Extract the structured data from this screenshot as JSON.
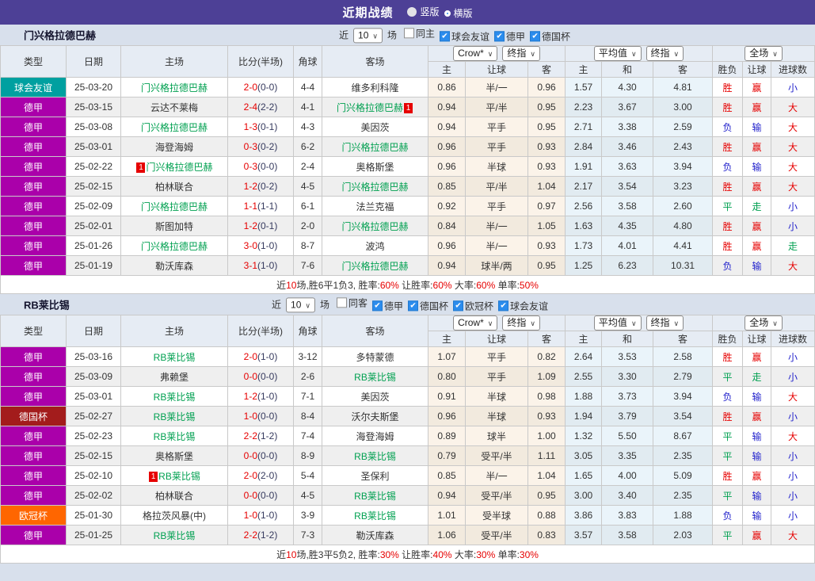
{
  "topbar": {
    "title": "近期战绩",
    "options": [
      {
        "label": "竖版",
        "selected": false
      },
      {
        "label": "横版",
        "selected": true
      }
    ]
  },
  "table_header": {
    "static": [
      "类型",
      "日期",
      "主场",
      "比分(半场)",
      "角球",
      "客场"
    ],
    "dropdowns": {
      "handicap": [
        "Crow*",
        "终指"
      ],
      "average": [
        "平均值",
        "终指"
      ],
      "result": [
        "全场"
      ]
    },
    "sub_labels": [
      "主",
      "让球",
      "客",
      "主",
      "和",
      "客",
      "胜负",
      "让球",
      "进球数"
    ]
  },
  "legend_colors": {
    "德甲": "#aa00aa",
    "德国杯": "#a31c1c",
    "欧冠杯": "#ff6600",
    "球会友谊": "#00a0a0"
  },
  "sections": [
    {
      "team": "门兴格拉德巴赫",
      "filters": {
        "near_label": "近",
        "count": "10",
        "games_label": "场",
        "checkboxes": [
          {
            "label": "同主",
            "checked": false
          },
          {
            "label": "球会友谊",
            "checked": true
          },
          {
            "label": "德甲",
            "checked": true
          },
          {
            "label": "德国杯",
            "checked": true
          }
        ]
      },
      "rows": [
        {
          "type": "球会友谊",
          "date": "25-03-20",
          "home": {
            "name": "门兴格拉德巴赫",
            "hl": true
          },
          "score_ft": "2-0",
          "score_ht": "(0-0)",
          "corner": "4-4",
          "away": {
            "name": "维多利科隆",
            "hl": false
          },
          "hcp": [
            "0.86",
            "半/一",
            "0.96"
          ],
          "avg": [
            "1.57",
            "4.30",
            "4.81"
          ],
          "results": [
            [
              "胜",
              "r"
            ],
            [
              "赢",
              "r"
            ],
            [
              "小",
              "b"
            ]
          ]
        },
        {
          "type": "德甲",
          "date": "25-03-15",
          "home": {
            "name": "云达不莱梅",
            "hl": false
          },
          "score_ft": "2-4",
          "score_ht": "(2-2)",
          "corner": "4-1",
          "away": {
            "name": "门兴格拉德巴赫",
            "hl": true,
            "badge": "1",
            "badge_pos": "after"
          },
          "hcp": [
            "0.94",
            "平/半",
            "0.95"
          ],
          "avg": [
            "2.23",
            "3.67",
            "3.00"
          ],
          "results": [
            [
              "胜",
              "r"
            ],
            [
              "赢",
              "r"
            ],
            [
              "大",
              "r"
            ]
          ]
        },
        {
          "type": "德甲",
          "date": "25-03-08",
          "home": {
            "name": "门兴格拉德巴赫",
            "hl": true
          },
          "score_ft": "1-3",
          "score_ht": "(0-1)",
          "corner": "4-3",
          "away": {
            "name": "美因茨",
            "hl": false
          },
          "hcp": [
            "0.94",
            "平手",
            "0.95"
          ],
          "avg": [
            "2.71",
            "3.38",
            "2.59"
          ],
          "results": [
            [
              "负",
              "b"
            ],
            [
              "输",
              "b"
            ],
            [
              "大",
              "r"
            ]
          ]
        },
        {
          "type": "德甲",
          "date": "25-03-01",
          "home": {
            "name": "海登海姆",
            "hl": false
          },
          "score_ft": "0-3",
          "score_ht": "(0-2)",
          "corner": "6-2",
          "away": {
            "name": "门兴格拉德巴赫",
            "hl": true
          },
          "hcp": [
            "0.96",
            "平手",
            "0.93"
          ],
          "avg": [
            "2.84",
            "3.46",
            "2.43"
          ],
          "results": [
            [
              "胜",
              "r"
            ],
            [
              "赢",
              "r"
            ],
            [
              "大",
              "r"
            ]
          ]
        },
        {
          "type": "德甲",
          "date": "25-02-22",
          "home": {
            "name": "门兴格拉德巴赫",
            "hl": true,
            "badge": "1",
            "badge_pos": "before"
          },
          "score_ft": "0-3",
          "score_ht": "(0-0)",
          "corner": "2-4",
          "away": {
            "name": "奥格斯堡",
            "hl": false
          },
          "hcp": [
            "0.96",
            "半球",
            "0.93"
          ],
          "avg": [
            "1.91",
            "3.63",
            "3.94"
          ],
          "results": [
            [
              "负",
              "b"
            ],
            [
              "输",
              "b"
            ],
            [
              "大",
              "r"
            ]
          ]
        },
        {
          "type": "德甲",
          "date": "25-02-15",
          "home": {
            "name": "柏林联合",
            "hl": false
          },
          "score_ft": "1-2",
          "score_ht": "(0-2)",
          "corner": "4-5",
          "away": {
            "name": "门兴格拉德巴赫",
            "hl": true
          },
          "hcp": [
            "0.85",
            "平/半",
            "1.04"
          ],
          "avg": [
            "2.17",
            "3.54",
            "3.23"
          ],
          "results": [
            [
              "胜",
              "r"
            ],
            [
              "赢",
              "r"
            ],
            [
              "大",
              "r"
            ]
          ]
        },
        {
          "type": "德甲",
          "date": "25-02-09",
          "home": {
            "name": "门兴格拉德巴赫",
            "hl": true
          },
          "score_ft": "1-1",
          "score_ht": "(1-1)",
          "corner": "6-1",
          "away": {
            "name": "法兰克福",
            "hl": false
          },
          "hcp": [
            "0.92",
            "平手",
            "0.97"
          ],
          "avg": [
            "2.56",
            "3.58",
            "2.60"
          ],
          "results": [
            [
              "平",
              "g"
            ],
            [
              "走",
              "g"
            ],
            [
              "小",
              "b"
            ]
          ]
        },
        {
          "type": "德甲",
          "date": "25-02-01",
          "home": {
            "name": "斯图加特",
            "hl": false
          },
          "score_ft": "1-2",
          "score_ht": "(0-1)",
          "corner": "2-0",
          "away": {
            "name": "门兴格拉德巴赫",
            "hl": true
          },
          "hcp": [
            "0.84",
            "半/一",
            "1.05"
          ],
          "avg": [
            "1.63",
            "4.35",
            "4.80"
          ],
          "results": [
            [
              "胜",
              "r"
            ],
            [
              "赢",
              "r"
            ],
            [
              "小",
              "b"
            ]
          ]
        },
        {
          "type": "德甲",
          "date": "25-01-26",
          "home": {
            "name": "门兴格拉德巴赫",
            "hl": true
          },
          "score_ft": "3-0",
          "score_ht": "(1-0)",
          "corner": "8-7",
          "away": {
            "name": "波鸿",
            "hl": false
          },
          "hcp": [
            "0.96",
            "半/一",
            "0.93"
          ],
          "avg": [
            "1.73",
            "4.01",
            "4.41"
          ],
          "results": [
            [
              "胜",
              "r"
            ],
            [
              "赢",
              "r"
            ],
            [
              "走",
              "g"
            ]
          ]
        },
        {
          "type": "德甲",
          "date": "25-01-19",
          "home": {
            "name": "勒沃库森",
            "hl": false
          },
          "score_ft": "3-1",
          "score_ht": "(1-0)",
          "corner": "7-6",
          "away": {
            "name": "门兴格拉德巴赫",
            "hl": true
          },
          "hcp": [
            "0.94",
            "球半/两",
            "0.95"
          ],
          "avg": [
            "1.25",
            "6.23",
            "10.31"
          ],
          "results": [
            [
              "负",
              "b"
            ],
            [
              "输",
              "b"
            ],
            [
              "大",
              "r"
            ]
          ]
        }
      ],
      "summary": [
        {
          "t": "近",
          "c": "d"
        },
        {
          "t": "10",
          "c": "r"
        },
        {
          "t": "场,胜6平1负3, 胜率:",
          "c": "d"
        },
        {
          "t": "60%",
          "c": "r"
        },
        {
          "t": " 让胜率:",
          "c": "d"
        },
        {
          "t": "60%",
          "c": "r"
        },
        {
          "t": " 大率:",
          "c": "d"
        },
        {
          "t": "60%",
          "c": "r"
        },
        {
          "t": " 单率:",
          "c": "d"
        },
        {
          "t": "50%",
          "c": "r"
        }
      ]
    },
    {
      "team": "RB莱比锡",
      "filters": {
        "near_label": "近",
        "count": "10",
        "games_label": "场",
        "checkboxes": [
          {
            "label": "同客",
            "checked": false
          },
          {
            "label": "德甲",
            "checked": true
          },
          {
            "label": "德国杯",
            "checked": true
          },
          {
            "label": "欧冠杯",
            "checked": true
          },
          {
            "label": "球会友谊",
            "checked": true
          }
        ]
      },
      "rows": [
        {
          "type": "德甲",
          "date": "25-03-16",
          "home": {
            "name": "RB莱比锡",
            "hl": true
          },
          "score_ft": "2-0",
          "score_ht": "(1-0)",
          "corner": "3-12",
          "away": {
            "name": "多特蒙德",
            "hl": false
          },
          "hcp": [
            "1.07",
            "平手",
            "0.82"
          ],
          "avg": [
            "2.64",
            "3.53",
            "2.58"
          ],
          "results": [
            [
              "胜",
              "r"
            ],
            [
              "赢",
              "r"
            ],
            [
              "小",
              "b"
            ]
          ]
        },
        {
          "type": "德甲",
          "date": "25-03-09",
          "home": {
            "name": "弗赖堡",
            "hl": false
          },
          "score_ft": "0-0",
          "score_ht": "(0-0)",
          "corner": "2-6",
          "away": {
            "name": "RB莱比锡",
            "hl": true
          },
          "hcp": [
            "0.80",
            "平手",
            "1.09"
          ],
          "avg": [
            "2.55",
            "3.30",
            "2.79"
          ],
          "results": [
            [
              "平",
              "g"
            ],
            [
              "走",
              "g"
            ],
            [
              "小",
              "b"
            ]
          ]
        },
        {
          "type": "德甲",
          "date": "25-03-01",
          "home": {
            "name": "RB莱比锡",
            "hl": true
          },
          "score_ft": "1-2",
          "score_ht": "(1-0)",
          "corner": "7-1",
          "away": {
            "name": "美因茨",
            "hl": false
          },
          "hcp": [
            "0.91",
            "半球",
            "0.98"
          ],
          "avg": [
            "1.88",
            "3.73",
            "3.94"
          ],
          "results": [
            [
              "负",
              "b"
            ],
            [
              "输",
              "b"
            ],
            [
              "大",
              "r"
            ]
          ]
        },
        {
          "type": "德国杯",
          "date": "25-02-27",
          "home": {
            "name": "RB莱比锡",
            "hl": true
          },
          "score_ft": "1-0",
          "score_ht": "(0-0)",
          "corner": "8-4",
          "away": {
            "name": "沃尔夫斯堡",
            "hl": false
          },
          "hcp": [
            "0.96",
            "半球",
            "0.93"
          ],
          "avg": [
            "1.94",
            "3.79",
            "3.54"
          ],
          "results": [
            [
              "胜",
              "r"
            ],
            [
              "赢",
              "r"
            ],
            [
              "小",
              "b"
            ]
          ]
        },
        {
          "type": "德甲",
          "date": "25-02-23",
          "home": {
            "name": "RB莱比锡",
            "hl": true
          },
          "score_ft": "2-2",
          "score_ht": "(1-2)",
          "corner": "7-4",
          "away": {
            "name": "海登海姆",
            "hl": false
          },
          "hcp": [
            "0.89",
            "球半",
            "1.00"
          ],
          "avg": [
            "1.32",
            "5.50",
            "8.67"
          ],
          "results": [
            [
              "平",
              "g"
            ],
            [
              "输",
              "b"
            ],
            [
              "大",
              "r"
            ]
          ]
        },
        {
          "type": "德甲",
          "date": "25-02-15",
          "home": {
            "name": "奥格斯堡",
            "hl": false
          },
          "score_ft": "0-0",
          "score_ht": "(0-0)",
          "corner": "8-9",
          "away": {
            "name": "RB莱比锡",
            "hl": true
          },
          "hcp": [
            "0.79",
            "受平/半",
            "1.11"
          ],
          "avg": [
            "3.05",
            "3.35",
            "2.35"
          ],
          "results": [
            [
              "平",
              "g"
            ],
            [
              "输",
              "b"
            ],
            [
              "小",
              "b"
            ]
          ]
        },
        {
          "type": "德甲",
          "date": "25-02-10",
          "home": {
            "name": "RB莱比锡",
            "hl": true,
            "badge": "1",
            "badge_pos": "before"
          },
          "score_ft": "2-0",
          "score_ht": "(2-0)",
          "corner": "5-4",
          "away": {
            "name": "圣保利",
            "hl": false
          },
          "hcp": [
            "0.85",
            "半/一",
            "1.04"
          ],
          "avg": [
            "1.65",
            "4.00",
            "5.09"
          ],
          "results": [
            [
              "胜",
              "r"
            ],
            [
              "赢",
              "r"
            ],
            [
              "小",
              "b"
            ]
          ]
        },
        {
          "type": "德甲",
          "date": "25-02-02",
          "home": {
            "name": "柏林联合",
            "hl": false
          },
          "score_ft": "0-0",
          "score_ht": "(0-0)",
          "corner": "4-5",
          "away": {
            "name": "RB莱比锡",
            "hl": true
          },
          "hcp": [
            "0.94",
            "受平/半",
            "0.95"
          ],
          "avg": [
            "3.00",
            "3.40",
            "2.35"
          ],
          "results": [
            [
              "平",
              "g"
            ],
            [
              "输",
              "b"
            ],
            [
              "小",
              "b"
            ]
          ]
        },
        {
          "type": "欧冠杯",
          "date": "25-01-30",
          "home": {
            "name": "格拉茨风暴(中)",
            "hl": false
          },
          "score_ft": "1-0",
          "score_ht": "(1-0)",
          "corner": "3-9",
          "away": {
            "name": "RB莱比锡",
            "hl": true
          },
          "hcp": [
            "1.01",
            "受半球",
            "0.88"
          ],
          "avg": [
            "3.86",
            "3.83",
            "1.88"
          ],
          "results": [
            [
              "负",
              "b"
            ],
            [
              "输",
              "b"
            ],
            [
              "小",
              "b"
            ]
          ]
        },
        {
          "type": "德甲",
          "date": "25-01-25",
          "home": {
            "name": "RB莱比锡",
            "hl": true
          },
          "score_ft": "2-2",
          "score_ht": "(1-2)",
          "corner": "7-3",
          "away": {
            "name": "勒沃库森",
            "hl": false
          },
          "hcp": [
            "1.06",
            "受平/半",
            "0.83"
          ],
          "avg": [
            "3.57",
            "3.58",
            "2.03"
          ],
          "results": [
            [
              "平",
              "g"
            ],
            [
              "赢",
              "r"
            ],
            [
              "大",
              "r"
            ]
          ]
        }
      ],
      "summary": [
        {
          "t": "近",
          "c": "d"
        },
        {
          "t": "10",
          "c": "r"
        },
        {
          "t": "场,胜3平5负2, 胜率:",
          "c": "d"
        },
        {
          "t": "30%",
          "c": "r"
        },
        {
          "t": " 让胜率:",
          "c": "d"
        },
        {
          "t": "40%",
          "c": "r"
        },
        {
          "t": " 大率:",
          "c": "d"
        },
        {
          "t": "30%",
          "c": "r"
        },
        {
          "t": " 单率:",
          "c": "d"
        },
        {
          "t": "30%",
          "c": "r"
        }
      ]
    }
  ]
}
